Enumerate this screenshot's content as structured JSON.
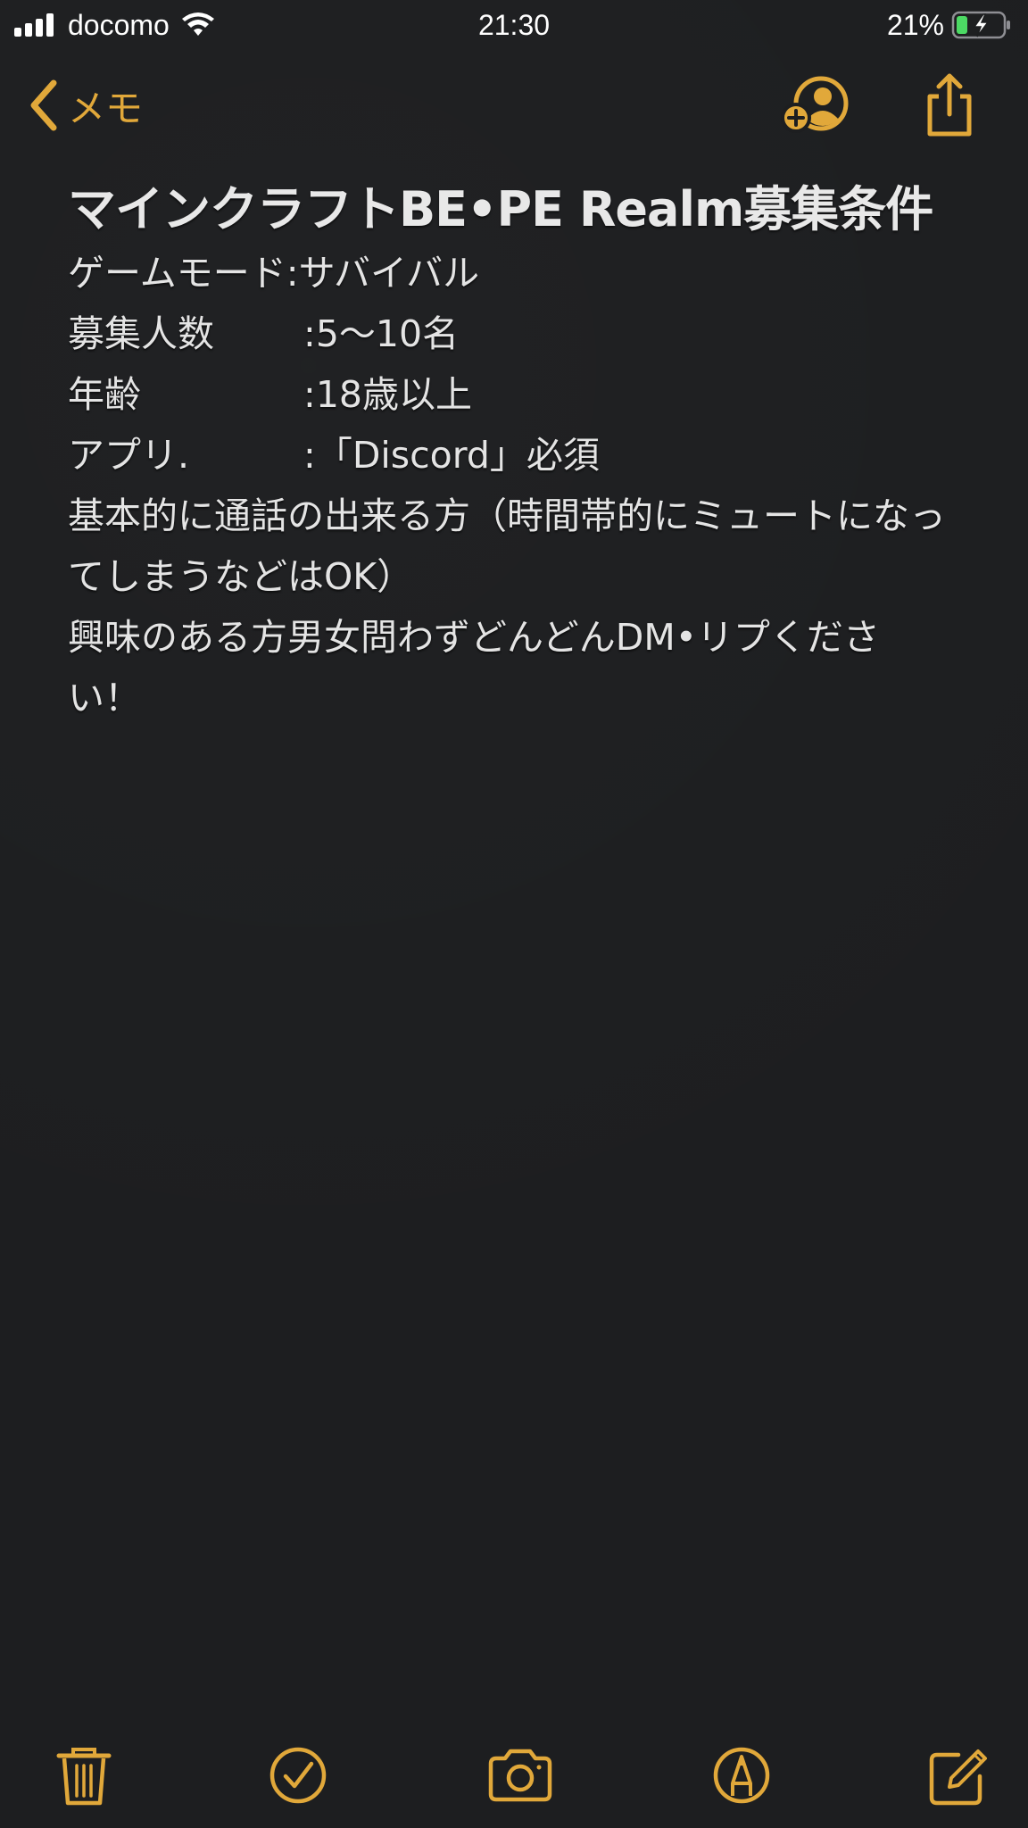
{
  "status_bar": {
    "carrier": "docomo",
    "time": "21:30",
    "battery_percent": "21%",
    "battery_level": 0.21,
    "signal_bars": 4,
    "charging": true
  },
  "nav": {
    "back_label": "メモ",
    "add_people_icon": "person-add-icon",
    "share_icon": "share-icon"
  },
  "note": {
    "title": "マインクラフトBE•PE Realm募集条件",
    "fields": [
      {
        "label": "ゲームモード",
        "value": ":サバイバル"
      },
      {
        "label": "募集人数",
        "value": ":5〜10名"
      },
      {
        "label": "年齢",
        "value": ":18歳以上"
      },
      {
        "label": "アプリ.",
        "value": ":「Discord」必須"
      }
    ],
    "paragraphs": [
      "基本的に通話の出来る方（時間帯的にミュートになってしまうなどはOK）",
      "興味のある方男女問わずどんどんDM•リプください！"
    ]
  },
  "toolbar": {
    "items": [
      "trash-icon",
      "checklist-icon",
      "camera-icon",
      "markup-icon",
      "compose-icon"
    ]
  },
  "colors": {
    "accent": "#e1a83a",
    "background": "#1d1e20",
    "text": "#e4e4e4",
    "battery_fill": "#4cd964"
  }
}
